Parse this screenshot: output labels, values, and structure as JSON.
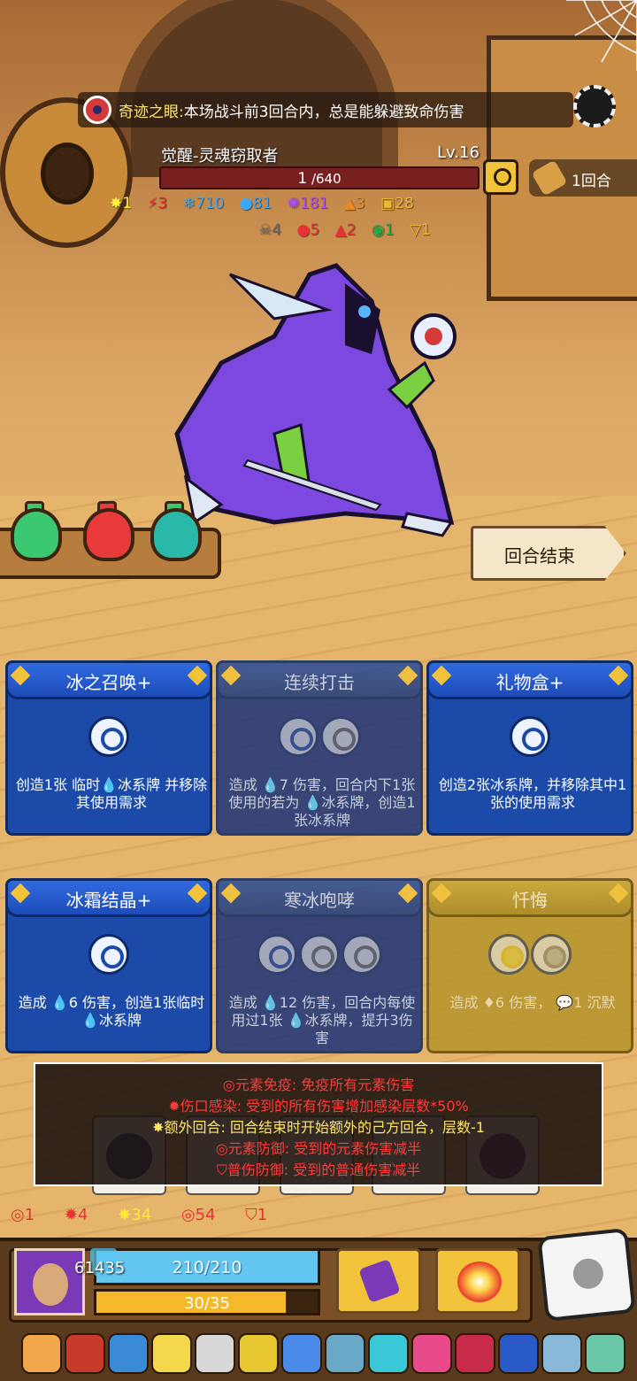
{
  "banner": {
    "title": "奇迹之眼:",
    "text": "本场战斗前3回合内，总是能躲避致命伤害"
  },
  "enemy": {
    "name": "觉醒-灵魂窃取者",
    "level": "Lv.16",
    "hp_current": "1",
    "hp_max": "/640",
    "hp_fraction": 0.0016
  },
  "round": {
    "label": "1回合"
  },
  "enemy_stats_row1": [
    {
      "icon": "yellow-star-icon",
      "value": "1",
      "color": "#fff23a"
    },
    {
      "icon": "red-claw-icon",
      "value": "3",
      "color": "#e83232"
    },
    {
      "icon": "snowflake-icon",
      "value": "710",
      "color": "#3aa8ff"
    },
    {
      "icon": "blue-bubble-icon",
      "value": "81",
      "color": "#3aa8ff"
    },
    {
      "icon": "purple-splat-icon",
      "value": "181",
      "color": "#b24bff"
    },
    {
      "icon": "flame-orange-icon",
      "value": "3",
      "color": "#e88a2a"
    },
    {
      "icon": "lock-icon",
      "value": "28",
      "color": "#e8b830"
    }
  ],
  "enemy_stats_row2": [
    {
      "icon": "skull-icon",
      "value": "4",
      "color": "#6a6a6a"
    },
    {
      "icon": "blood-drop-icon",
      "value": "5",
      "color": "#e83232"
    },
    {
      "icon": "fire-icon",
      "value": "2",
      "color": "#e83232"
    },
    {
      "icon": "swirl-icon",
      "value": "1",
      "color": "#1fa84a"
    },
    {
      "icon": "triangle-icon",
      "value": "1",
      "color": "#e8c830"
    }
  ],
  "end_turn": {
    "label": "回合结束"
  },
  "cards": [
    {
      "title": "冰之召唤+",
      "slots": [
        "blue"
      ],
      "desc_a": "创造1张 临时",
      "desc_b": "冰系牌 并移除其使用需求",
      "style": "normal"
    },
    {
      "title": "连续打击",
      "slots": [
        "blue",
        "grey"
      ],
      "desc": "造成 💧7 伤害，回合内下1张使用的若为 💧冰系牌，创造1张冰系牌",
      "style": "dim"
    },
    {
      "title": "礼物盒+",
      "slots": [
        "blue"
      ],
      "desc": "创造2张冰系牌，并移除其中1张的使用需求",
      "style": "normal"
    },
    {
      "title": "冰霜结晶+",
      "slots": [
        "blue"
      ],
      "desc": "造成 💧6 伤害，创造1张临时 💧冰系牌",
      "style": "normal"
    },
    {
      "title": "寒冰咆哮",
      "slots": [
        "blue",
        "grey",
        "grey"
      ],
      "desc": "造成 💧12 伤害，回合内每使用过1张 💧冰系牌，提升3伤害",
      "style": "dim"
    },
    {
      "title": "忏悔",
      "slots": [
        "lemon",
        "lemongrey"
      ],
      "desc": "造成 ♦6 伤害， 💬1 沉默",
      "style": "yel"
    }
  ],
  "tooltip": [
    {
      "key": "元素免疫:",
      "text": " 免疫所有元素伤害",
      "icon": "target-icon"
    },
    {
      "key": "伤口感染:",
      "text": " 受到的所有伤害增加感染层数*50%",
      "icon": "virus-icon"
    },
    {
      "key": "额外回合:",
      "text": " 回合结束时开始额外的己方回合，层数-1",
      "icon": "yellow-star-icon",
      "key_color": "#ffe66b"
    },
    {
      "key": "元素防御:",
      "text": " 受到的元素伤害减半",
      "icon": "target-shield-icon"
    },
    {
      "key": "普伤防御:",
      "text": " 受到的普通伤害减半",
      "icon": "shield-icon"
    }
  ],
  "player_buffs": [
    {
      "icon": "target-icon",
      "value": "1",
      "color": "#e83232"
    },
    {
      "icon": "virus-icon",
      "value": "4",
      "color": "#e83232"
    },
    {
      "icon": "yellow-star-icon",
      "value": "34",
      "color": "#ffe63a"
    },
    {
      "icon": "target-shield-icon",
      "value": "54",
      "color": "#e83232"
    },
    {
      "icon": "shield-icon",
      "value": "1",
      "color": "#e83232"
    }
  ],
  "player": {
    "shield": "61435",
    "hp": "210/210",
    "hp_fraction": 1.0,
    "energy": "30/35",
    "energy_fraction": 0.857
  },
  "relics": [
    "donut-relic-icon",
    "bracelet-relic-icon",
    "crystal-relic-icon",
    "cheese-relic-icon",
    "scroll-relic-icon",
    "chain-relic-icon",
    "mushroom-relic-icon",
    "horn-relic-icon",
    "ice-gem-relic-icon",
    "pink-mushroom-relic-icon",
    "red-jaws-relic-icon",
    "blue-robe-relic-icon",
    "dagger-relic-icon",
    "bird-relic-icon"
  ]
}
